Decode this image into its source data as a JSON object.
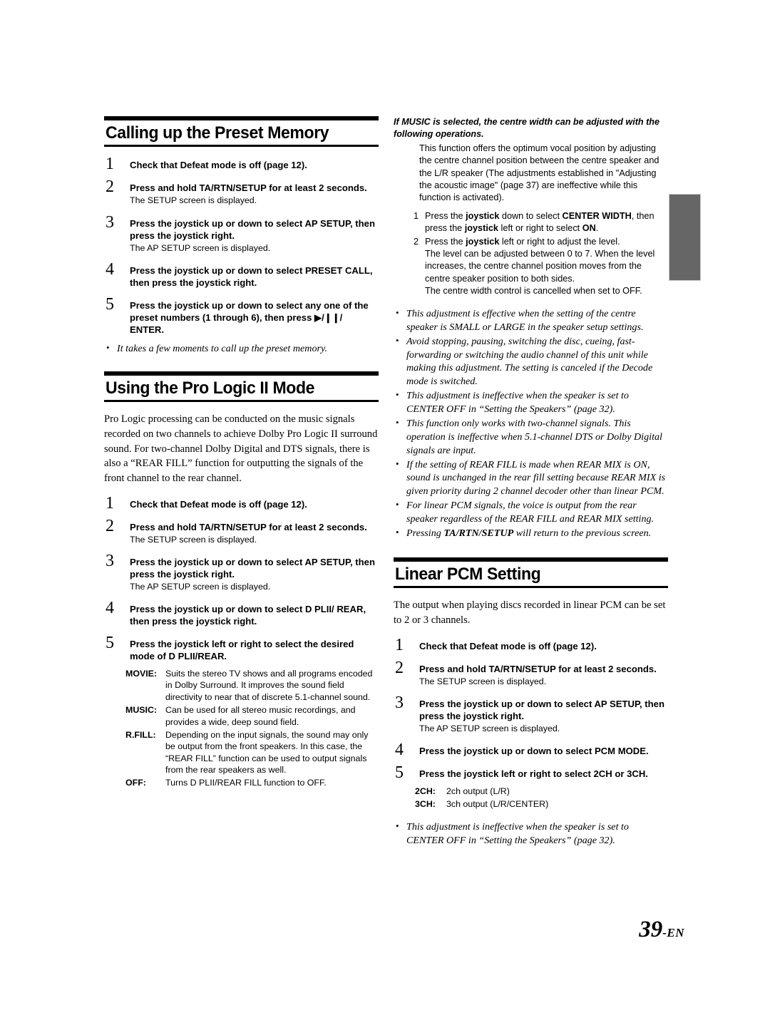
{
  "page": {
    "folio_number": "39",
    "folio_suffix": "-EN"
  },
  "left_column": {
    "section1": {
      "heading": "Calling up the Preset Memory",
      "steps": [
        {
          "num": "1",
          "text_html": "Check that Defeat mode is off (page 12).",
          "note": ""
        },
        {
          "num": "2",
          "text_html": "Press and hold <b>TA/RTN/SETUP</b> for at least 2 seconds.",
          "note": "The SETUP screen is displayed."
        },
        {
          "num": "3",
          "text_html": "Press the <b>joystick</b> up or down to select <b>AP SETUP</b>, then press the <b>joystick</b> right.",
          "note": "The AP SETUP screen is displayed."
        },
        {
          "num": "4",
          "text_html": "Press the <b>joystick</b> up or down to select <b>PRESET CALL</b>, then press the <b>joystick</b> right.",
          "note": ""
        },
        {
          "num": "5",
          "text_html": "Press the <b>joystick</b> up or down to select any one of the preset numbers (1 through 6), then press ▶/❙❙/ <b>ENTER</b>.",
          "note": ""
        }
      ],
      "notes": [
        "It takes a few moments to call up the preset memory."
      ]
    },
    "section2": {
      "heading": "Using the Pro Logic II Mode",
      "intro": "Pro Logic processing can be conducted on the music signals recorded on two channels to achieve Dolby Pro Logic II surround sound.  For two-channel Dolby Digital and DTS signals, there is also a “REAR FILL” function for outputting the signals of the front channel to the rear channel.",
      "steps": [
        {
          "num": "1",
          "text_html": "Check that Defeat mode is off (page 12).",
          "note": ""
        },
        {
          "num": "2",
          "text_html": "Press and hold <b>TA/RTN/SETUP</b> for at least 2 seconds.",
          "note": "The SETUP screen is displayed."
        },
        {
          "num": "3",
          "text_html": "Press the <b>joystick</b> up or down to select <b>AP SETUP</b>, then press the <b>joystick</b> right.",
          "note": "The AP SETUP screen is displayed."
        },
        {
          "num": "4",
          "text_html": "Press the <b>joystick</b> up or down to select <b>D PLII/ REAR</b>, then press the <b>joystick</b> right.",
          "note": ""
        },
        {
          "num": "5",
          "text_html": "Press the <b>joystick</b> left or right to select the desired mode of D PLII/REAR.",
          "note": ""
        }
      ],
      "modes": [
        {
          "term": "MOVIE:",
          "desc": "Suits the stereo TV shows and all programs encoded in Dolby Surround. It improves the sound field directivity to near that of discrete 5.1-channel sound."
        },
        {
          "term": "MUSIC:",
          "desc": "Can be used for all stereo music recordings, and provides a wide, deep sound field."
        },
        {
          "term": "R.FILL:",
          "desc": "Depending on the input signals, the sound may only be output from the front speakers. In this case, the “REAR FILL” function can be used to output signals from the rear speakers as well."
        },
        {
          "term": "OFF:",
          "desc": "Turns D PLII/REAR FILL function to OFF."
        }
      ]
    }
  },
  "right_column": {
    "centre_width": {
      "lead": "If MUSIC is selected, the centre width can be adjusted with the following operations.",
      "description": "This function offers the optimum vocal position by adjusting the centre channel position between the centre speaker and the L/R speaker (The adjustments established in \"Adjusting the acoustic image\" (page 37) are ineffective while this function is activated).",
      "substeps": [
        {
          "num": "1",
          "text_html": "Press the <b>joystick</b> down to select <b>CENTER WIDTH</b>, then press the <b>joystick</b> left or right to select <b>ON</b>.",
          "sub": []
        },
        {
          "num": "2",
          "text_html": "Press the <b>joystick</b> left or right to adjust the level.",
          "sub": [
            "The level can be adjusted between 0 to 7. When the level increases, the centre channel position moves from the centre speaker position to both sides.",
            "The centre width control is cancelled when set to OFF."
          ]
        }
      ],
      "notes_html": [
        "This adjustment is effective when the setting of the centre speaker is SMALL or LARGE in the speaker setup settings.",
        "Avoid stopping, pausing, switching the disc, cueing, fast-forwarding or switching the audio channel of this unit while making this adjustment. The setting is canceled if the Decode mode is switched.",
        "This adjustment is ineffective when the speaker is set to CENTER OFF in “Setting the Speakers” (page 32).",
        "This function only works with two-channel signals. This operation is ineffective when 5.1-channel DTS or Dolby Digital signals are input.",
        "If the setting of REAR FILL is made when REAR MIX is ON, sound is unchanged in the rear fill setting because REAR MIX is given priority during 2 channel decoder other than linear PCM.",
        "For linear PCM signals, the voice is output from the rear speaker regardless of the REAR FILL and REAR MIX setting.",
        "Pressing <b>TA/RTN/SETUP</b> will return to the previous screen."
      ]
    },
    "section3": {
      "heading": "Linear PCM Setting",
      "intro": "The output when playing discs recorded in linear PCM can be set to 2 or 3 channels.",
      "steps": [
        {
          "num": "1",
          "text_html": "Check that Defeat mode is off (page 12).",
          "note": ""
        },
        {
          "num": "2",
          "text_html": "Press and hold <b>TA/RTN/SETUP</b> for at least 2 seconds.",
          "note": "The SETUP screen is displayed."
        },
        {
          "num": "3",
          "text_html": "Press the <b>joystick</b> up or down to select <b>AP SETUP</b>, then press the <b>joystick</b> right.",
          "note": "The AP SETUP screen is displayed."
        },
        {
          "num": "4",
          "text_html": "Press the <b>joystick</b> up or down to select <b>PCM MODE</b>.",
          "note": ""
        },
        {
          "num": "5",
          "text_html": "Press the <b>joystick</b> left or right to select <b>2CH</b> or <b>3CH</b>.",
          "note": ""
        }
      ],
      "modes": [
        {
          "term": "2CH:",
          "desc": "2ch output (L/R)"
        },
        {
          "term": "3CH:",
          "desc": "3ch output (L/R/CENTER)"
        }
      ],
      "notes": [
        "This adjustment is ineffective when the speaker is set to CENTER OFF in “Setting the Speakers” (page 32)."
      ]
    }
  }
}
